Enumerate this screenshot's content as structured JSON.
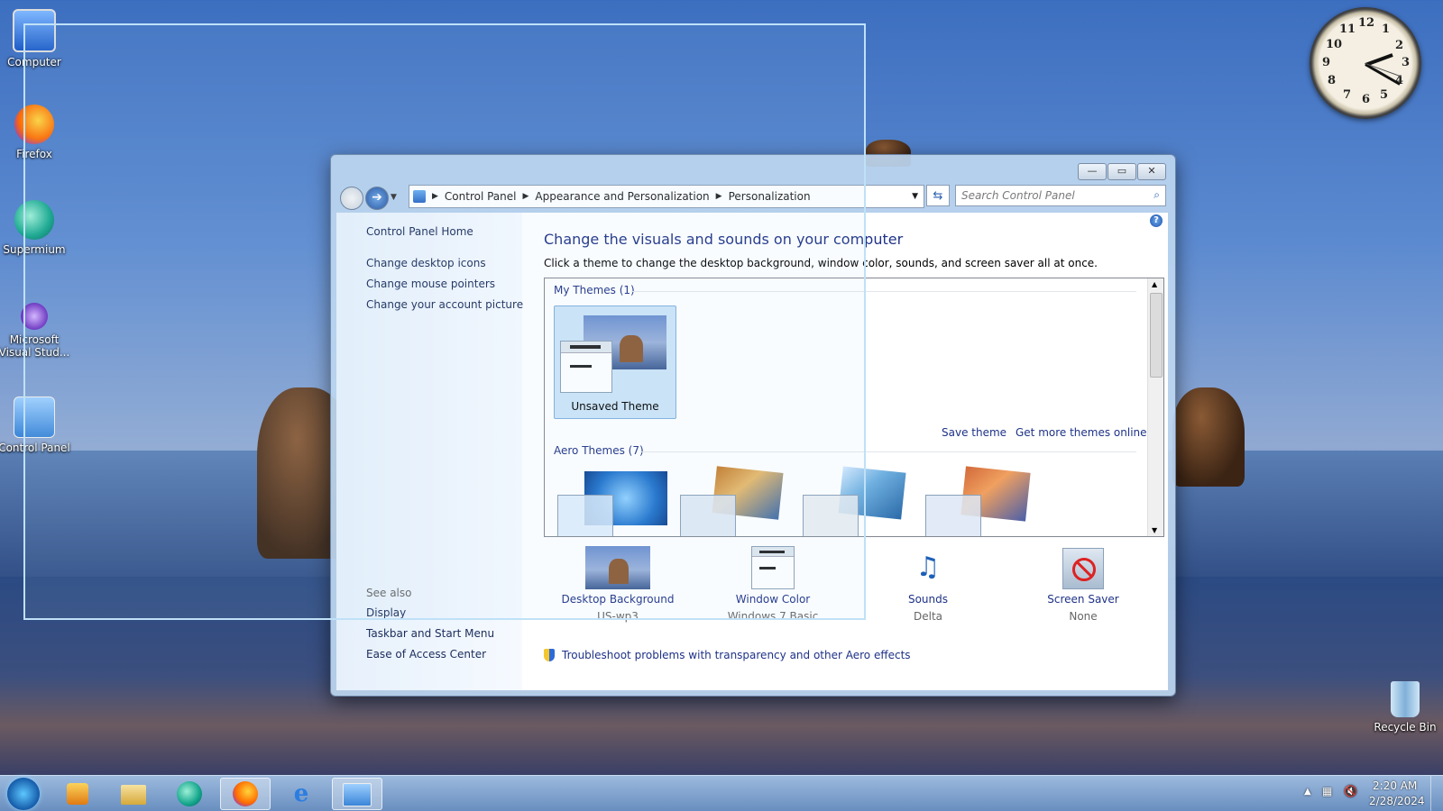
{
  "desktop": {
    "icons": [
      {
        "label": "Computer"
      },
      {
        "label": "Firefox"
      },
      {
        "label": "Supermium"
      },
      {
        "label": "Microsoft Visual Stud..."
      },
      {
        "label": "Control Panel"
      }
    ],
    "recycle_bin": "Recycle Bin"
  },
  "clock": {
    "numbers": [
      "12",
      "1",
      "2",
      "3",
      "4",
      "5",
      "6",
      "7",
      "8",
      "9",
      "10",
      "11"
    ]
  },
  "window": {
    "controls": {
      "minimize": "—",
      "maximize": "▭",
      "close": "✕"
    },
    "breadcrumb": [
      "Control Panel",
      "Appearance and Personalization",
      "Personalization"
    ],
    "search_placeholder": "Search Control Panel",
    "help": "?"
  },
  "sidebar": {
    "home": "Control Panel Home",
    "links": [
      "Change desktop icons",
      "Change mouse pointers",
      "Change your account picture"
    ],
    "see_also": "See also",
    "see_also_links": [
      "Display",
      "Taskbar and Start Menu",
      "Ease of Access Center"
    ]
  },
  "main": {
    "title": "Change the visuals and sounds on your computer",
    "description": "Click a theme to change the desktop background, window color, sounds, and screen saver all at once.",
    "my_themes_header": "My Themes (1)",
    "unsaved_theme": "Unsaved Theme",
    "save_theme": "Save theme",
    "get_more": "Get more themes online",
    "aero_header": "Aero Themes (7)",
    "bottom": [
      {
        "label": "Desktop Background",
        "value": "US-wp3"
      },
      {
        "label": "Window Color",
        "value": "Windows 7 Basic"
      },
      {
        "label": "Sounds",
        "value": "Delta"
      },
      {
        "label": "Screen Saver",
        "value": "None"
      }
    ],
    "troubleshoot": "Troubleshoot problems with transparency and other Aero effects"
  },
  "taskbar": {
    "time": "2:20 AM",
    "date": "2/28/2024"
  },
  "colors": {
    "link": "#1e3287",
    "accent": "#3d6fc0"
  }
}
